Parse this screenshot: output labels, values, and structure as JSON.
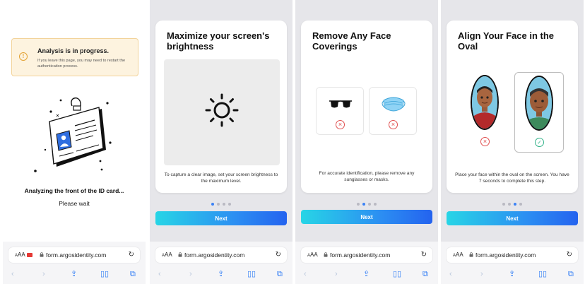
{
  "screens": [
    {
      "warning": {
        "title": "Analysis is in progress.",
        "text": "If you leave this page, you may need to restart the authentication process."
      },
      "status": "Analyzing the front of the ID card...",
      "wait": "Please wait"
    },
    {
      "title": "Maximize your screen's brightness",
      "description": "To capture a clear image, set your screen brightness to the maximum level.",
      "next": "Next",
      "active_step": 1
    },
    {
      "title": "Remove Any Face Coverings",
      "description": "For accurate identification, please remove any sunglasses or masks.",
      "next": "Next",
      "active_step": 2
    },
    {
      "title": "Align Your Face in the Oval",
      "description": "Place your face within the oval on the screen. You have 7 seconds to complete this step.",
      "next": "Next",
      "active_step": 3
    }
  ],
  "browser": {
    "aa": "AA",
    "url": "form.argosidentity.com"
  },
  "icons": {
    "warning": "warning-circle-icon",
    "sun": "sun-icon",
    "glasses": "sunglasses-icon",
    "mask": "face-mask-icon",
    "wrong": "x-circle-icon",
    "correct": "check-circle-icon"
  },
  "colors": {
    "accent": "#2c8ff2",
    "error": "#e05151",
    "success": "#34b38a",
    "warning": "#e3a233"
  }
}
